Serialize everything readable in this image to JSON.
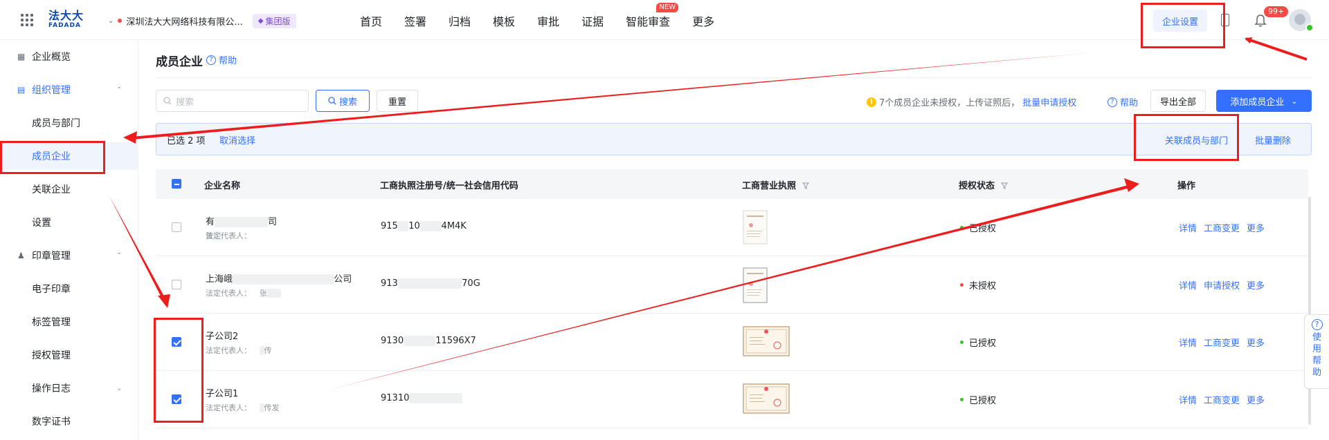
{
  "header": {
    "brand_cn": "法大大",
    "brand_en": "FADADA",
    "org_name": "深圳法大大网络科技有限公...",
    "org_badge": "集团版",
    "nav": [
      {
        "label": "首页"
      },
      {
        "label": "签署"
      },
      {
        "label": "归档"
      },
      {
        "label": "模板"
      },
      {
        "label": "审批"
      },
      {
        "label": "证据"
      },
      {
        "label": "智能审查",
        "tag": "NEW"
      },
      {
        "label": "更多"
      }
    ],
    "enterprise_settings": "企业设置",
    "notification_count": "99+"
  },
  "sidebar": {
    "items": [
      {
        "label": "企业概览",
        "icon": "overview-icon"
      },
      {
        "label": "组织管理",
        "icon": "org-icon",
        "expanded": true
      },
      {
        "label": "成员与部门"
      },
      {
        "label": "成员企业",
        "active": true
      },
      {
        "label": "关联企业"
      },
      {
        "label": "设置"
      },
      {
        "label": "印章管理",
        "icon": "seal-icon",
        "expanded": true
      },
      {
        "label": "电子印章"
      },
      {
        "label": "标签管理"
      },
      {
        "label": "授权管理"
      },
      {
        "label": "操作日志",
        "collapsed": true
      },
      {
        "label": "数字证书"
      }
    ]
  },
  "main": {
    "title": "成员企业",
    "help": "帮助",
    "search_placeholder": "搜索",
    "search_btn": "搜索",
    "reset_btn": "重置",
    "warn_text": "7个成员企业未授权，上传证照后，",
    "warn_link": "批量申请授权",
    "help2": "帮助",
    "export_btn": "导出全部",
    "add_btn": "添加成员企业",
    "selection": {
      "count_text": "已选 2 项",
      "cancel": "取消选择",
      "assoc": "关联成员与部门",
      "batch_delete": "批量删除"
    },
    "table": {
      "headers": [
        "企业名称",
        "工商执照注册号/统一社会信用代码",
        "工商营业执照",
        "授权状态",
        "操作"
      ],
      "rep_label": "法定代表人：",
      "rows": [
        {
          "name_a": "有",
          "name_b": "司",
          "rep": "曾",
          "code_a": "915",
          "code_b": "10",
          "code_c": "4M4K",
          "status": "已授权",
          "status_color": "#34c724",
          "ops": [
            "详情",
            "工商变更",
            "更多"
          ],
          "checked": false
        },
        {
          "name_a": "上海峨",
          "name_b": "公司",
          "rep": "张",
          "code_a": "913",
          "code_b": "",
          "code_c": "70G",
          "status": "未授权",
          "status_color": "#f54a45",
          "ops": [
            "详情",
            "申请授权",
            "更多"
          ],
          "checked": false
        },
        {
          "name_a": "子公司2",
          "name_b": "",
          "rep": "传",
          "code_a": "9130",
          "code_b": "",
          "code_c": "11596X7",
          "status": "已授权",
          "status_color": "#34c724",
          "ops": [
            "详情",
            "工商变更",
            "更多"
          ],
          "checked": true
        },
        {
          "name_a": "子公司1",
          "name_b": "",
          "rep": "传发",
          "code_a": "91310",
          "code_b": "",
          "code_c": "",
          "status": "已授权",
          "status_color": "#34c724",
          "ops": [
            "详情",
            "工商变更",
            "更多"
          ],
          "checked": true
        }
      ]
    }
  },
  "float_help": [
    "使",
    "用",
    "帮",
    "助"
  ]
}
